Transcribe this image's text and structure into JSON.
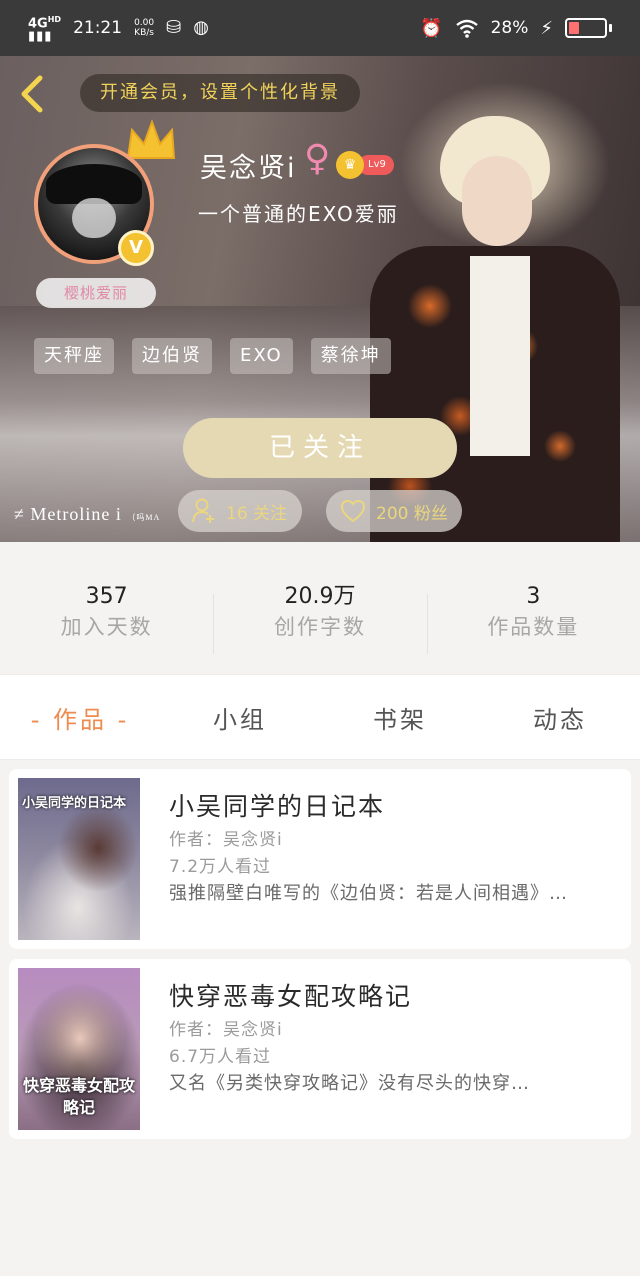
{
  "status_bar": {
    "network": "4G",
    "network_sup": "HD",
    "time": "21:21",
    "speed_value": "0.00",
    "speed_unit": "KB/s",
    "battery": "28%",
    "battery_level": 0.28
  },
  "header": {
    "vip_banner": "开通会员，设置个性化背景"
  },
  "profile": {
    "name": "吴念贤i",
    "gender_symbol": "♀",
    "level": "Lv9",
    "bio": "一个普通的EXO爱丽",
    "avatar_tag": "樱桃爱丽",
    "verified_mark": "V",
    "tags": [
      "天秤座",
      "边伯贤",
      "EXO",
      "蔡徐坤"
    ]
  },
  "actions": {
    "follow_label": "已关注",
    "following_label": "16 关注",
    "fans_label": "200 粉丝"
  },
  "watermark": {
    "main": "≠ Metroline i",
    "small": "（吗MA"
  },
  "stats": [
    {
      "value": "357",
      "label": "加入天数"
    },
    {
      "value": "20.9万",
      "label": "创作字数"
    },
    {
      "value": "3",
      "label": "作品数量"
    }
  ],
  "tabs": [
    "- 作品 -",
    "小组",
    "书架",
    "动态"
  ],
  "works": [
    {
      "cover_title": "小吴同学的日记本",
      "title": "小吴同学的日记本",
      "author": "作者：吴念贤i",
      "views": "7.2万人看过",
      "desc": "强推隔壁白唯写的《边伯贤：若是人间相遇》…"
    },
    {
      "cover_title": "快穿恶毒女配攻略记",
      "title": "快穿恶毒女配攻略记",
      "author": "作者：吴念贤i",
      "views": "6.7万人看过",
      "desc": "又名《另类快穿攻略记》没有尽头的快穿…"
    }
  ],
  "colors": {
    "accent": "#ef8b4f",
    "gold": "#f1d35a",
    "follow_button": "#e5d9b4",
    "gender": "#f08ab0"
  }
}
